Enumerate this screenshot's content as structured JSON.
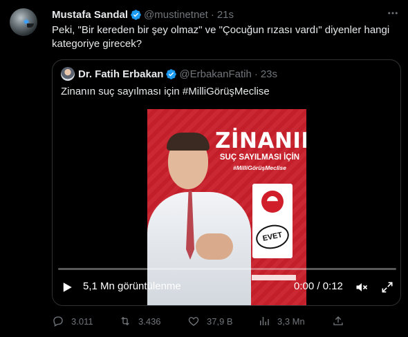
{
  "tweet": {
    "author_name": "Mustafa Sandal",
    "author_handle": "@mustinetnet",
    "separator": "·",
    "time": "21s",
    "text": "Peki, \"Bir kereden bir şey olmaz\" ve \"Çocuğun rızası vardı\" diyenler hangi kategoriye girecek?",
    "more_icon": "more-dots-icon"
  },
  "quote": {
    "author_name": "Dr. Fatih Erbakan",
    "author_handle": "@ErbakanFatih",
    "separator": "·",
    "time": "23s",
    "text": "Zinanın suç sayılması için #MilliGörüşMeclise",
    "poster": {
      "headline": "ZİNANIN",
      "subline": "SUÇ SAYILMASI İÇİN",
      "hashtag": "#MilliGörüşMeclise",
      "ballot_mark": "EVET"
    },
    "video": {
      "views": "5,1 Mn görüntülenme",
      "time": "0:00 / 0:12",
      "progress": 0.0
    }
  },
  "actions": {
    "replies": "3.011",
    "reposts": "3.436",
    "likes": "37,9 B",
    "views": "3,3 Mn"
  },
  "colors": {
    "background": "#000000",
    "text": "#e7e9ea",
    "muted": "#71767b",
    "border": "#2f3336",
    "verified": "#1d9bf0",
    "poster_red": "#c8202b"
  }
}
